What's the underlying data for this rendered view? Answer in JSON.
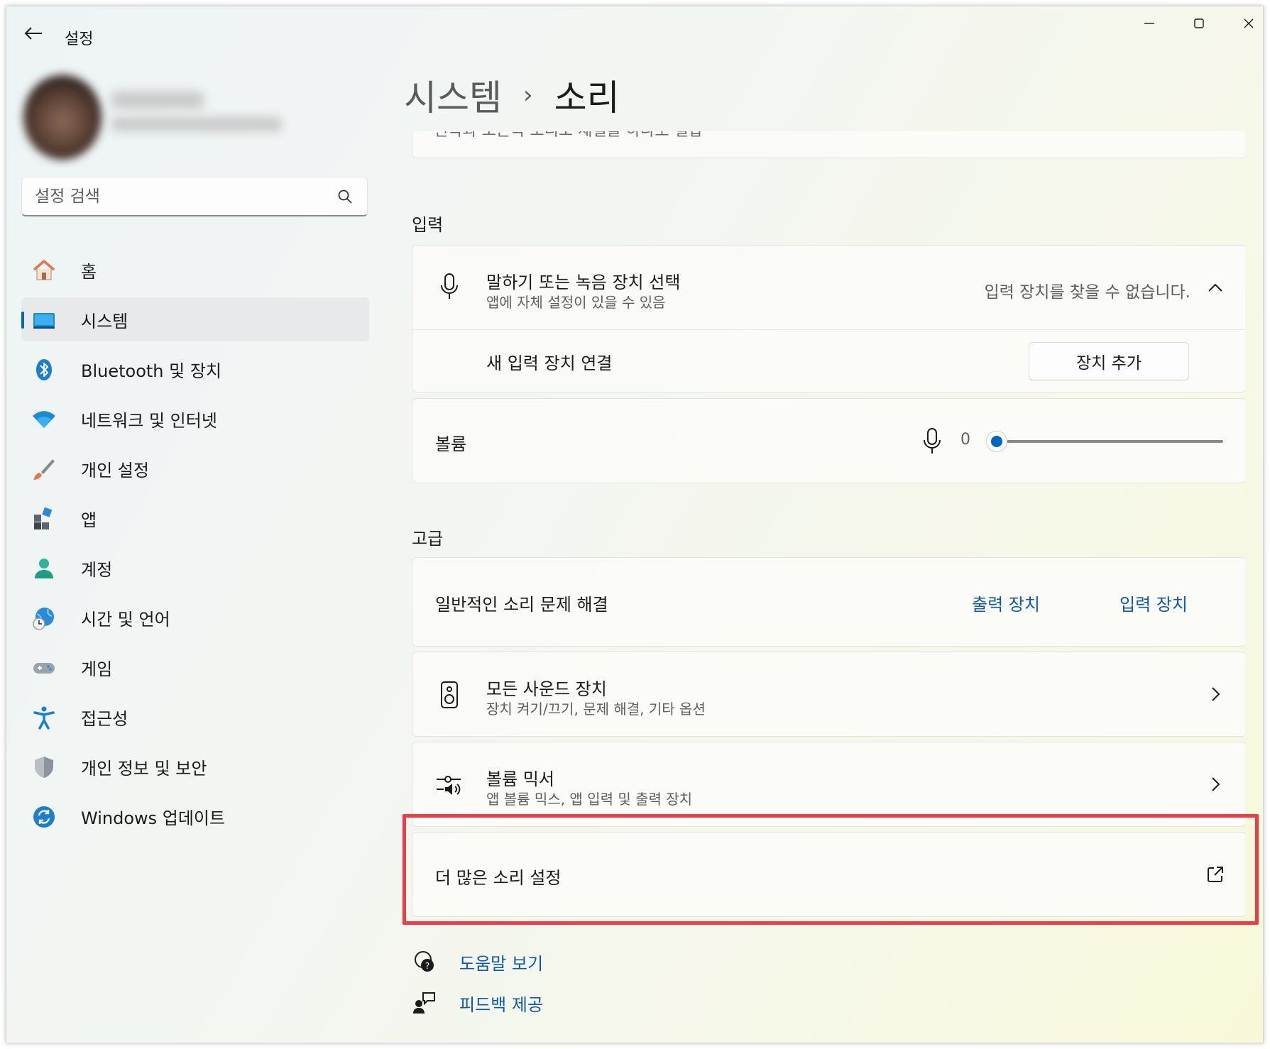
{
  "window": {
    "app_title": "설정",
    "controls": {
      "minimize": "minimize",
      "maximize": "maximize",
      "close": "close"
    }
  },
  "sidebar": {
    "search": {
      "placeholder": "설정 검색"
    },
    "items": [
      {
        "label": "홈",
        "icon": "home-icon",
        "active": false
      },
      {
        "label": "시스템",
        "icon": "system-icon",
        "active": true
      },
      {
        "label": "Bluetooth 및 장치",
        "icon": "bluetooth-icon",
        "active": false
      },
      {
        "label": "네트워크 및 인터넷",
        "icon": "wifi-icon",
        "active": false
      },
      {
        "label": "개인 설정",
        "icon": "brush-icon",
        "active": false
      },
      {
        "label": "앱",
        "icon": "apps-icon",
        "active": false
      },
      {
        "label": "계정",
        "icon": "account-icon",
        "active": false
      },
      {
        "label": "시간 및 언어",
        "icon": "globe-clock-icon",
        "active": false
      },
      {
        "label": "게임",
        "icon": "gamepad-icon",
        "active": false
      },
      {
        "label": "접근성",
        "icon": "accessibility-icon",
        "active": false
      },
      {
        "label": "개인 정보 및 보안",
        "icon": "shield-icon",
        "active": false
      },
      {
        "label": "Windows 업데이트",
        "icon": "update-icon",
        "active": false
      }
    ]
  },
  "breadcrumb": {
    "parent": "시스템",
    "separator": "›",
    "current": "소리"
  },
  "top_cut_card": {
    "text": "왼쪽과 오른쪽 오디오 채널을 하나로 결합"
  },
  "input_section": {
    "title": "입력",
    "device_select": {
      "title": "말하기 또는 녹음 장치 선택",
      "subtitle": "앱에 자체 설정이 있을 수 있음",
      "status": "입력 장치를 찾을 수 없습니다."
    },
    "connect": {
      "title": "새 입력 장치 연결",
      "button": "장치 추가"
    },
    "volume": {
      "title": "볼륨",
      "value": "0",
      "level": 0
    }
  },
  "advanced_section": {
    "title": "고급",
    "troubleshoot": {
      "title": "일반적인 소리 문제 해결",
      "link_output": "출력 장치",
      "link_input": "입력 장치"
    },
    "all_devices": {
      "title": "모든 사운드 장치",
      "subtitle": "장치 켜기/끄기, 문제 해결, 기타 옵션"
    },
    "mixer": {
      "title": "볼륨 믹서",
      "subtitle": "앱 볼륨 믹스, 앱 입력 및 출력 장치"
    },
    "more": {
      "title": "더 많은 소리 설정"
    }
  },
  "footer": {
    "help": "도움말 보기",
    "feedback": "피드백 제공"
  },
  "colors": {
    "accent": "#0067c0",
    "link": "#0f5aa8",
    "highlight": "#ee3b47"
  }
}
